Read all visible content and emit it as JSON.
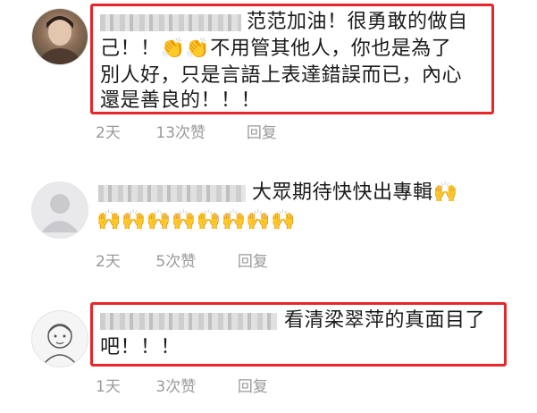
{
  "comments": [
    {
      "line1": "范范加油！很勇敢的做自",
      "line2": "己！！👏👏不用管其他人，你也是為了",
      "line3": "別人好，只是言語上表達錯誤而已，內心",
      "line4": "還是善良的！！！",
      "time": "2天",
      "likes": "13次赞",
      "reply": "回复"
    },
    {
      "line1": "大眾期待快快出專輯🙌",
      "line2": "🙌🙌🙌🙌🙌🙌🙌🙌",
      "time": "2天",
      "likes": "5次赞",
      "reply": "回复"
    },
    {
      "line1": "看清梁翠萍的真面目了",
      "line2": "吧！！！",
      "time": "1天",
      "likes": "3次赞",
      "reply": "回复"
    }
  ],
  "colors": {
    "highlight": "#e8262a",
    "meta": "#9a9a9a"
  }
}
